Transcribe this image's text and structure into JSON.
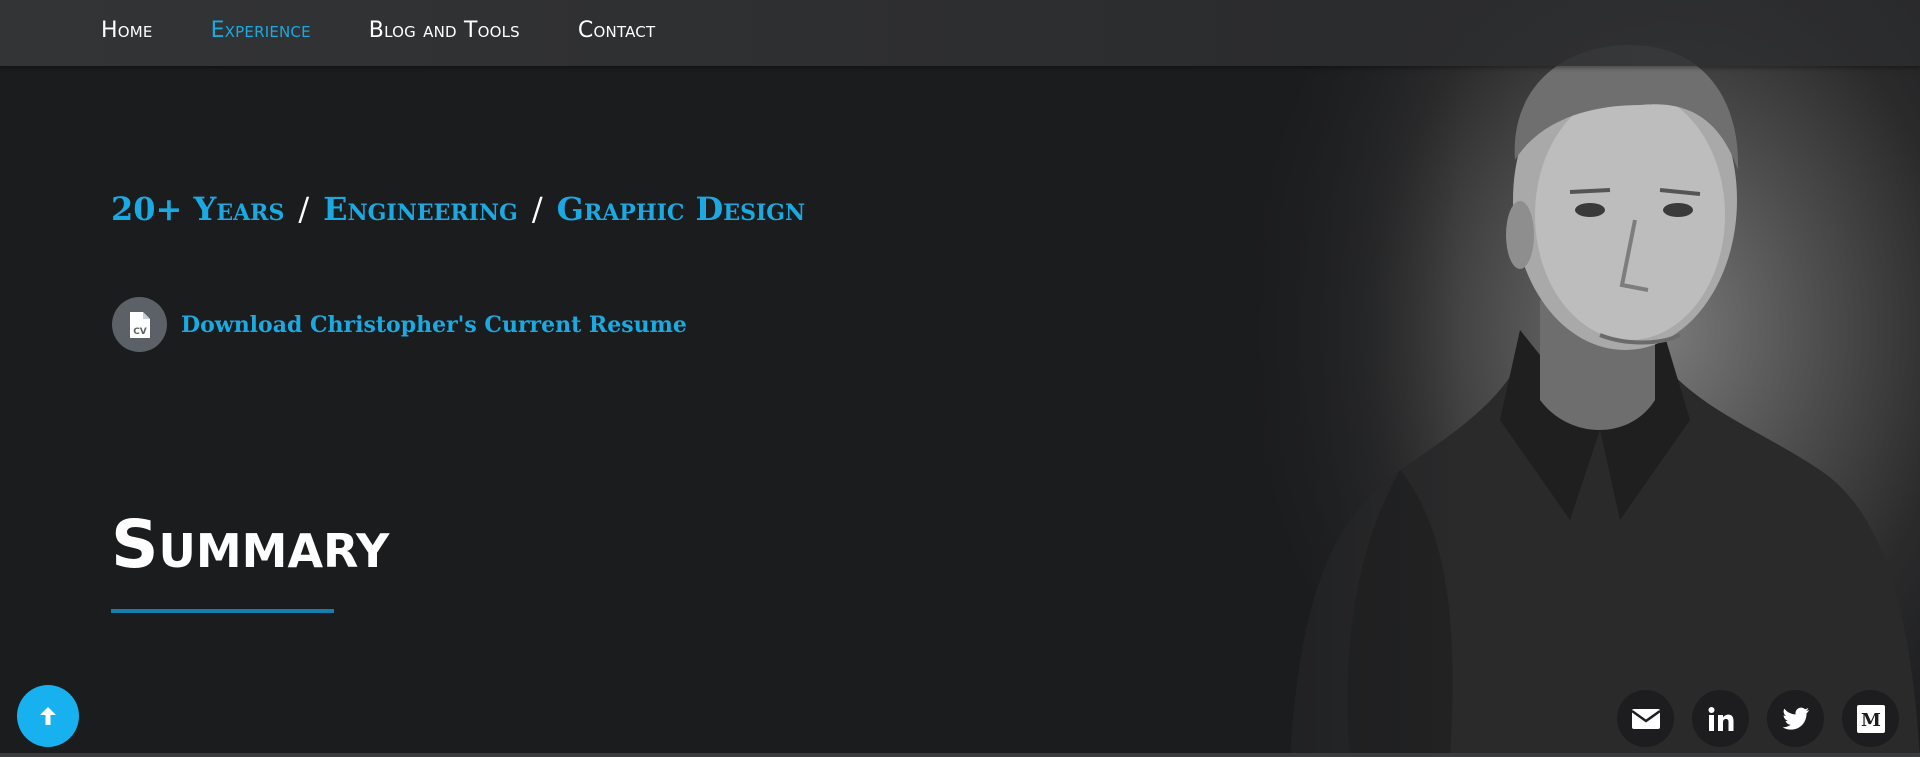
{
  "nav": {
    "items": [
      {
        "label": "Home",
        "active": false
      },
      {
        "label": "Experience",
        "active": true
      },
      {
        "label": "Blog and Tools",
        "active": false
      },
      {
        "label": "Contact",
        "active": false
      }
    ]
  },
  "hero": {
    "tagline": [
      "20+ Years",
      "Engineering",
      "Graphic Design"
    ],
    "tagline_separator": "/",
    "resume_icon_label": "CV",
    "resume_link": "Download Christopher's Current Resume",
    "summary_title": "Summary"
  },
  "social": {
    "icons": [
      "envelope-icon",
      "linkedin-icon",
      "twitter-icon",
      "medium-icon"
    ],
    "medium_label": "M"
  },
  "colors": {
    "accent": "#1ba9e1",
    "background": "#1b1c1e",
    "navbar": "#2f3032",
    "underline": "#137fb0",
    "back_to_top": "#18b1ef"
  }
}
